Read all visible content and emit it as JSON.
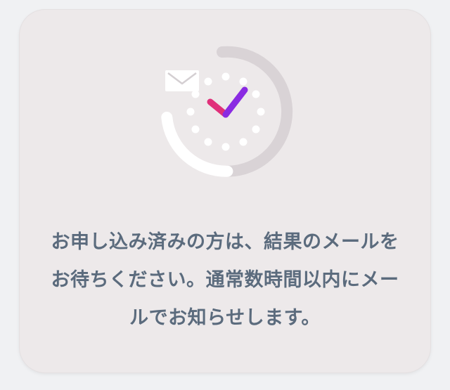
{
  "notice": {
    "lines": [
      "お申し込み済みの方は、結果のメールを",
      "お待ちください。通常数時間以内にメー",
      "ルでお知らせします。"
    ]
  },
  "colors": {
    "card_background": "#ede9ea",
    "text": "#5b6b7d",
    "progress_track": "#d9d3d6",
    "progress_fill": "#ffffff",
    "check_purple": "#8a2be2",
    "check_pink": "#e0307a"
  },
  "icons": {
    "envelope": "envelope-icon",
    "clock": "clock-icon",
    "check": "check-icon"
  }
}
